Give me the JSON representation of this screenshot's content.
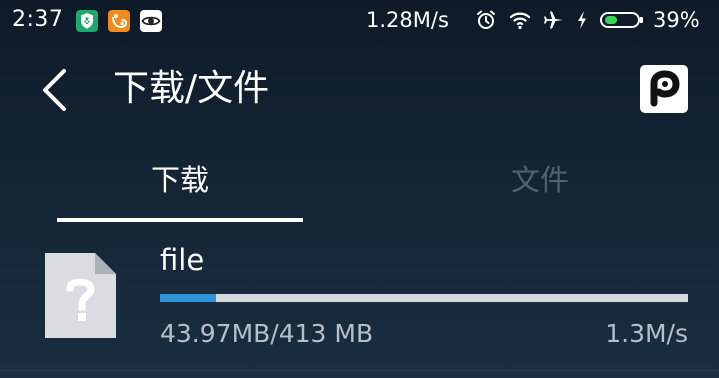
{
  "status_bar": {
    "time": "2:37",
    "network_speed": "1.28M/s",
    "battery_percent": "39%",
    "battery_level": 0.39,
    "notification_icons": [
      "shield-app-icon",
      "uc-browser-icon",
      "eye-app-icon"
    ],
    "system_icons": [
      "alarm-icon",
      "wifi-icon",
      "airplane-icon",
      "charging-icon",
      "battery-icon"
    ]
  },
  "header": {
    "title": "下载/文件",
    "back_icon": "chevron-left-icon",
    "brand_icon": "p-logo-icon"
  },
  "tabs": [
    {
      "label": "下载",
      "active": true
    },
    {
      "label": "文件",
      "active": false
    }
  ],
  "downloads": [
    {
      "name": "file",
      "icon": "unknown-file-icon",
      "progress": 0.1065,
      "size_text": "43.97MB/413 MB",
      "speed": "1.3M/s"
    }
  ],
  "colors": {
    "background": "#142434",
    "progress_fill": "#2f93d9",
    "progress_track": "#d6d9dc",
    "tab_inactive": "#53606d",
    "secondary_text": "#b6bec8",
    "battery_green": "#38d35a"
  }
}
